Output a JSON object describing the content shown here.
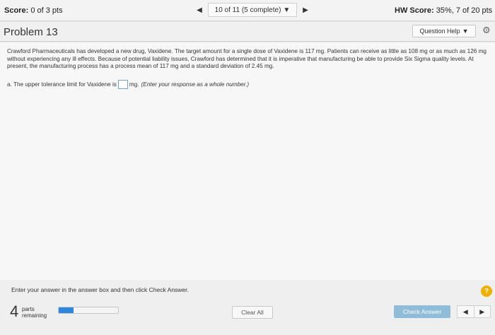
{
  "header": {
    "score_label": "Score:",
    "score_value": "0 of 3 pts",
    "nav_select": "10 of 11 (5 complete)",
    "prev_icon": "triangle-left-icon",
    "next_icon": "triangle-right-icon",
    "hw_label": "HW Score:",
    "hw_value": "35%, 7 of 20 pts"
  },
  "titlebar": {
    "problem": "Problem 13",
    "help_label": "Question Help",
    "gear_icon": "gear-icon"
  },
  "question": {
    "text": "Crawford Pharmaceuticals has developed a new drug, Vaxidene. The target amount for a single dose of Vaxidene is 117 mg. Patients can receive as little as 108 mg or as much as 126 mg without experiencing any ill effects. Because of potential liability issues, Crawford has determined that it is imperative that manufacturing be able to provide Six Sigma quality levels. At present, the manufacturing process has a process mean of 117 mg and a standard deviation of 2.45 mg.",
    "part_a_prefix": "a. The upper tolerance limit for Vaxidene is",
    "part_a_value": "",
    "part_a_unit": "mg.",
    "part_a_hint": "(Enter your response as a whole number.)"
  },
  "footer": {
    "instructions": "Enter your answer in the answer box and then click Check Answer.",
    "help_symbol": "?",
    "parts_count": "4",
    "parts_line1": "parts",
    "parts_line2": "remaining",
    "progress_fraction": 0.25,
    "clear_label": "Clear All",
    "check_label": "Check Answer"
  },
  "colors": {
    "accent": "#2e86de",
    "check_button": "#8fbcd9",
    "help_circle": "#f0b000"
  }
}
